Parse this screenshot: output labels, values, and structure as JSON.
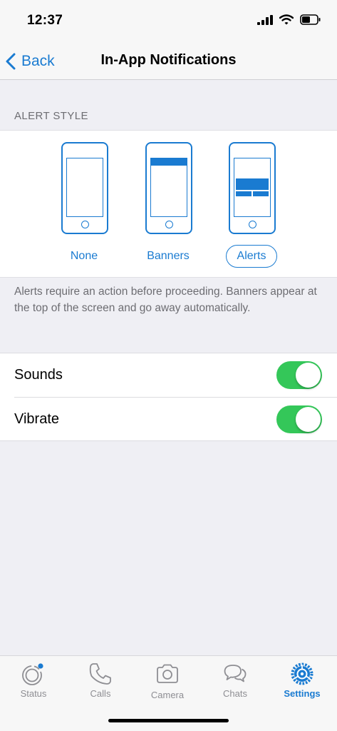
{
  "status_bar": {
    "time": "12:37"
  },
  "nav": {
    "back_label": "Back",
    "title": "In-App Notifications"
  },
  "alert_style": {
    "header": "ALERT STYLE",
    "options": [
      {
        "label": "None",
        "icon": "phone-none-icon",
        "selected": false
      },
      {
        "label": "Banners",
        "icon": "phone-banner-icon",
        "selected": false
      },
      {
        "label": "Alerts",
        "icon": "phone-alert-icon",
        "selected": true
      }
    ],
    "description": "Alerts require an action before proceeding. Banners appear at the top of the screen and go away automatically."
  },
  "settings": [
    {
      "label": "Sounds",
      "enabled": true
    },
    {
      "label": "Vibrate",
      "enabled": true
    }
  ],
  "tabs": [
    {
      "label": "Status",
      "icon": "status-icon",
      "active": false
    },
    {
      "label": "Calls",
      "icon": "phone-icon",
      "active": false
    },
    {
      "label": "Camera",
      "icon": "camera-icon",
      "active": false
    },
    {
      "label": "Chats",
      "icon": "chats-icon",
      "active": false
    },
    {
      "label": "Settings",
      "icon": "settings-gear-icon",
      "active": true
    }
  ],
  "colors": {
    "accent": "#1a7bd1",
    "toggle_on": "#34c759",
    "background": "#efeff4",
    "status_dot": "#1a7bd1"
  }
}
